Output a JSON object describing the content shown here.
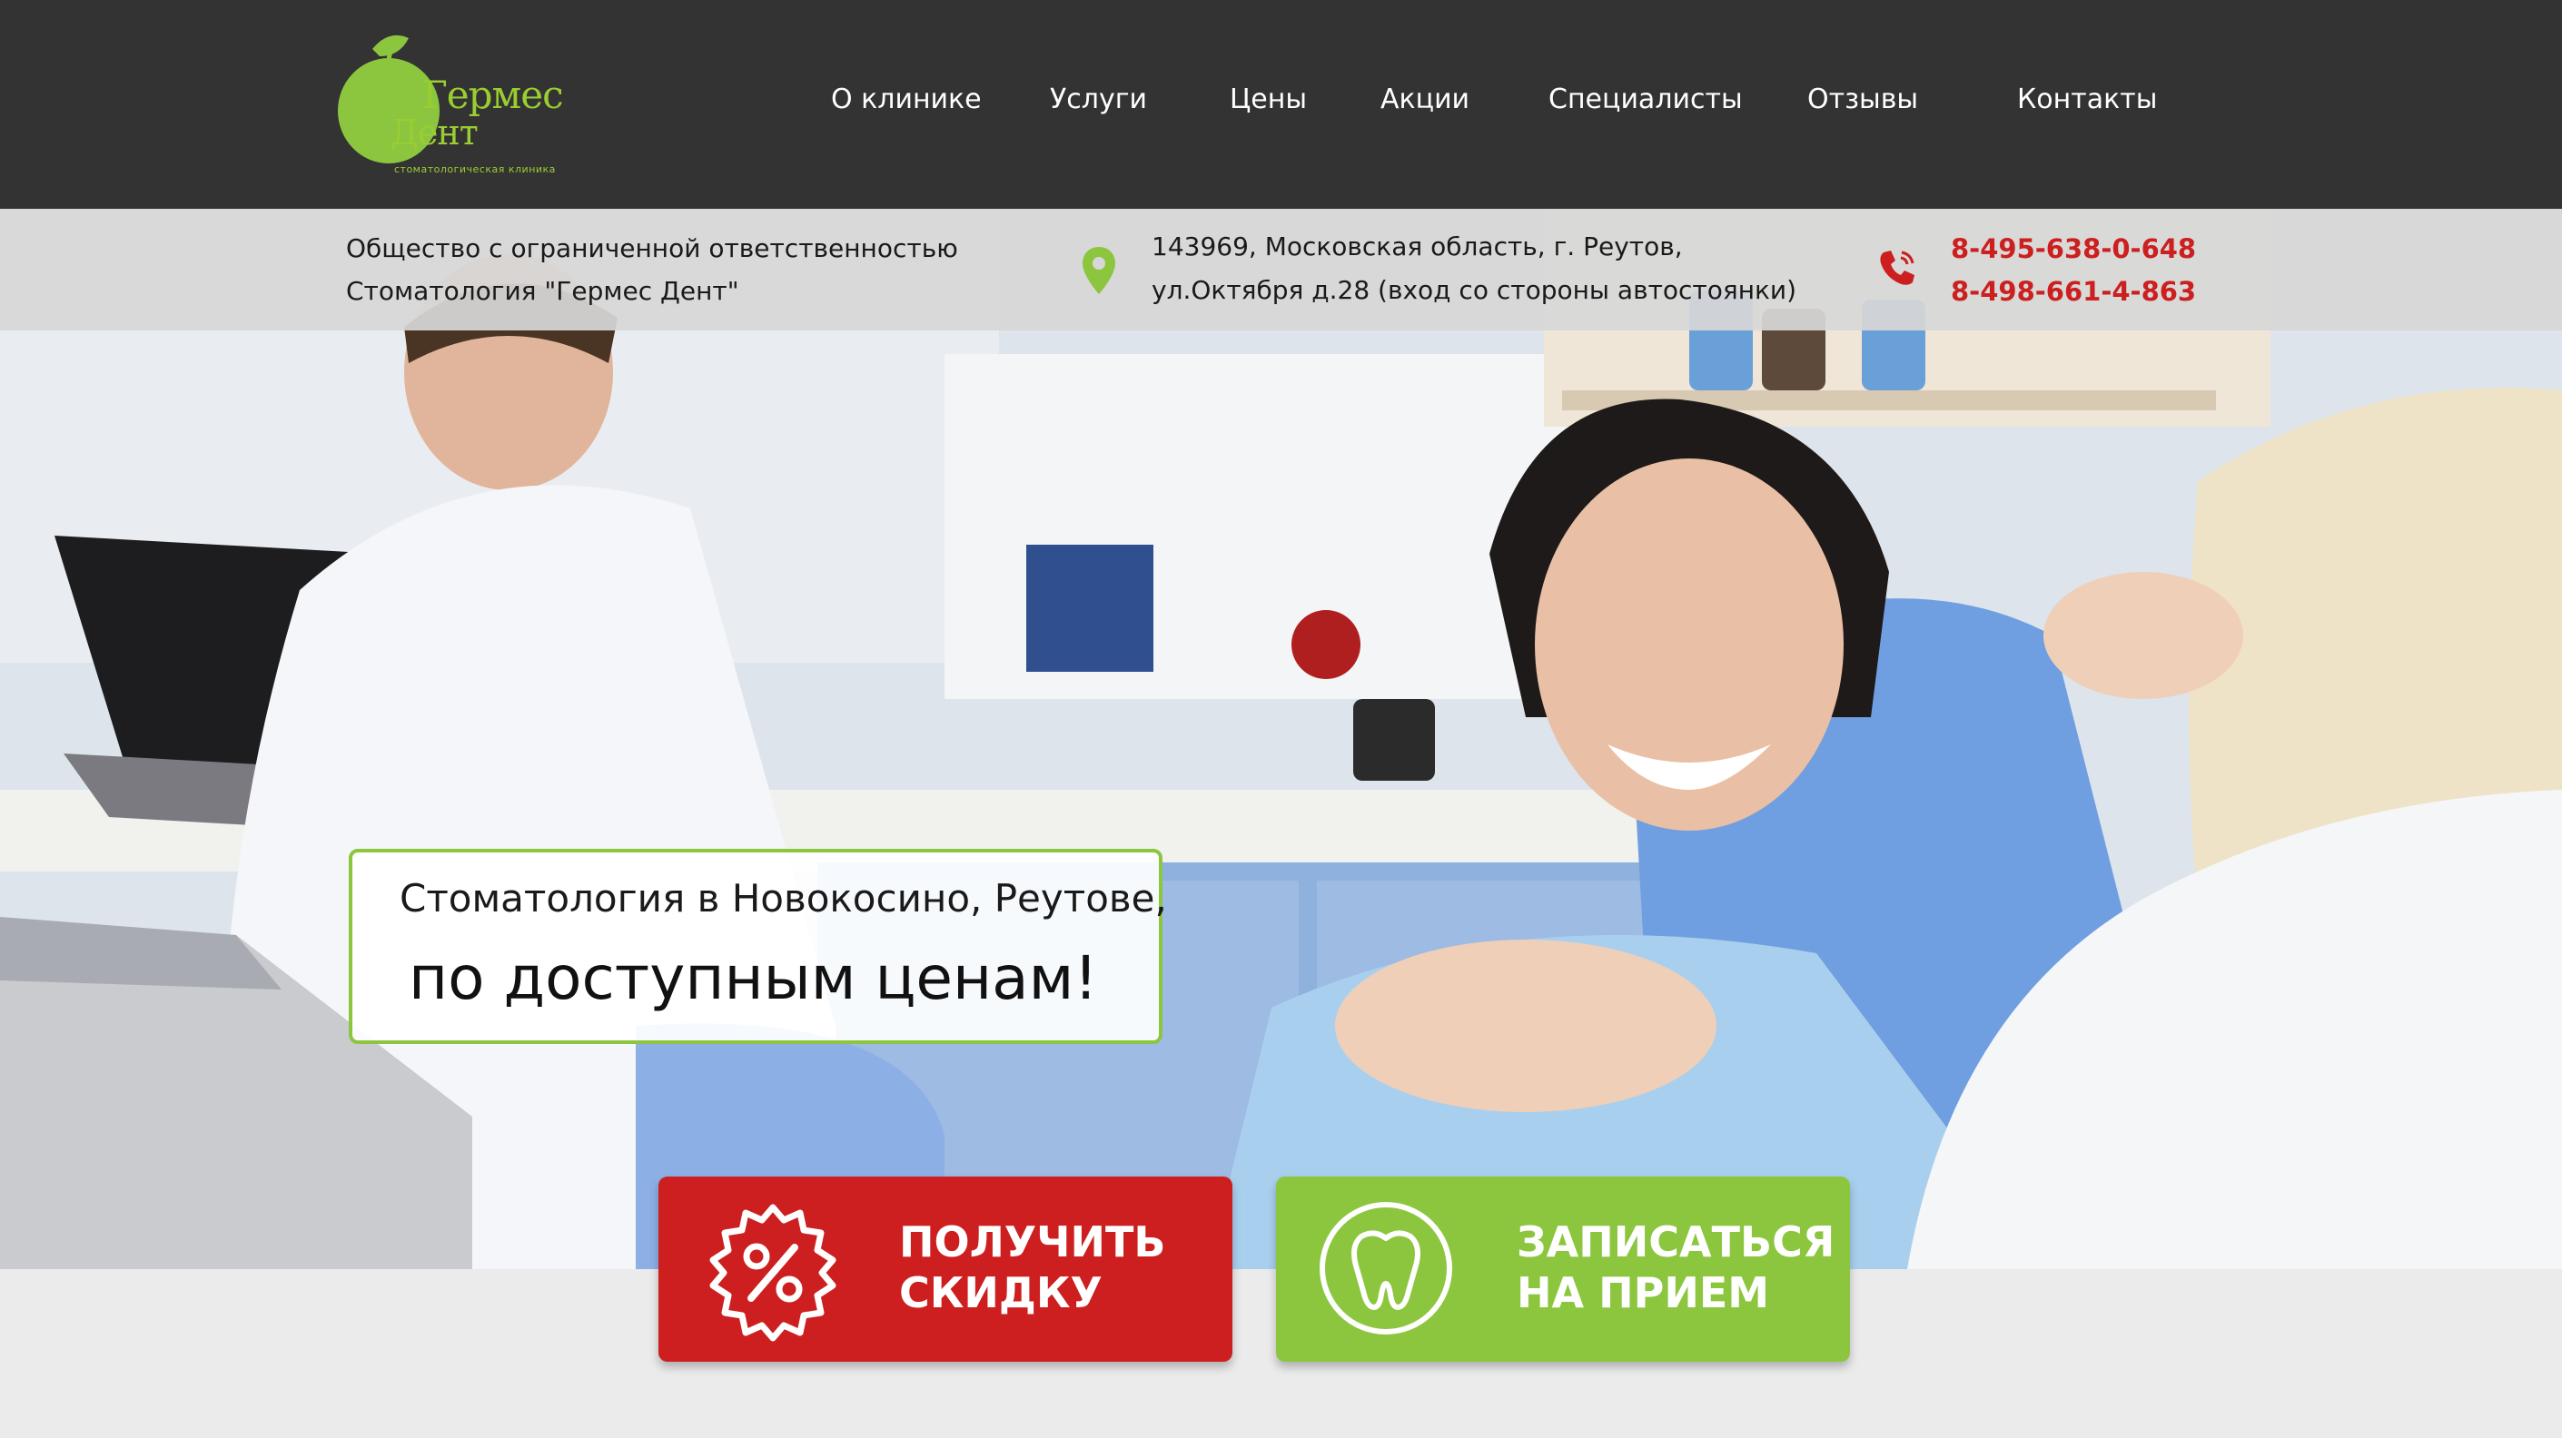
{
  "logo": {
    "line1": "Гермес",
    "line2": "Дент",
    "subtitle": "стоматологическая клиника"
  },
  "nav": {
    "items": [
      {
        "label": "О клинике"
      },
      {
        "label": "Услуги"
      },
      {
        "label": "Цены"
      },
      {
        "label": "Акции"
      },
      {
        "label": "Специалисты"
      },
      {
        "label": "Отзывы"
      },
      {
        "label": "Контакты"
      }
    ]
  },
  "info": {
    "company_line1": "Общество с ограниченной ответственностью",
    "company_line2": "Стоматология \"Гермес Дент\"",
    "address_line1": "143969, Московская область, г. Реутов,",
    "address_line2": "ул.Октября д.28 (вход со стороны автостоянки)",
    "phones": [
      "8-495-638-0-648",
      "8-498-661-4-863"
    ],
    "location_icon": "map-pin-icon",
    "phone_icon": "phone-icon"
  },
  "hero": {
    "slogan_line1": "Стоматология в Новокосино, Реутове,",
    "slogan_line2": "по доступным ценам!"
  },
  "cta": {
    "discount": {
      "label": "ПОЛУЧИТЬ\nСКИДКУ",
      "icon": "percent-badge-icon"
    },
    "appointment": {
      "label": "ЗАПИСАТЬСЯ\nНА ПРИЕМ",
      "icon": "tooth-icon"
    }
  },
  "colors": {
    "header_bg": "#333333",
    "accent_green": "#8cc63f",
    "accent_red": "#cd1f1f",
    "phone_red": "#cc1f1f"
  }
}
